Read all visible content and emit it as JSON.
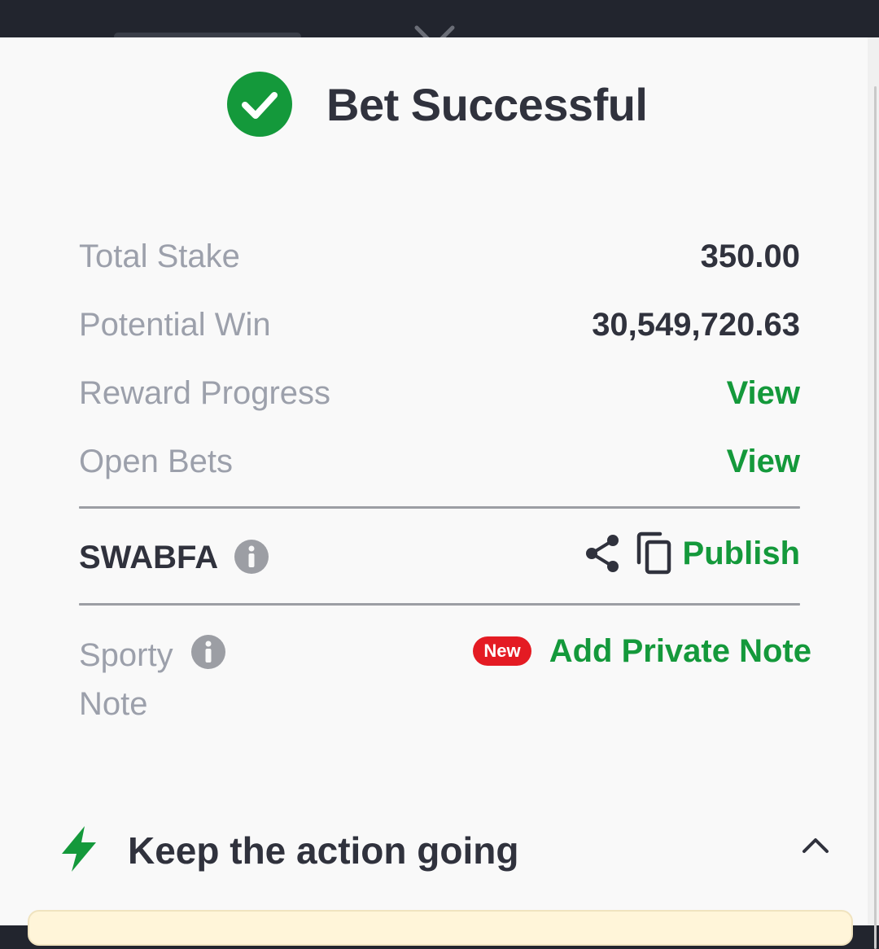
{
  "colors": {
    "accent_green": "#14993b",
    "text_dark": "#30323d",
    "text_muted": "#9ca0ab",
    "badge_red": "#e41b23",
    "sheet_bg": "#f9f9f9",
    "overlay_bg": "#22252e"
  },
  "header": {
    "icon": "check-circle-icon",
    "title": "Bet Successful"
  },
  "summary": {
    "rows": [
      {
        "label": "Total Stake",
        "value": "350.00"
      },
      {
        "label": "Potential Win",
        "value": "30,549,720.63"
      },
      {
        "label": "Reward Progress",
        "link": "View"
      },
      {
        "label": "Open Bets",
        "link": "View"
      }
    ]
  },
  "booking": {
    "code": "SWABFA",
    "info_icon": "info-icon",
    "share_icon": "share-icon",
    "copy_icon": "copy-icon",
    "publish_label": "Publish"
  },
  "note": {
    "label": "Sporty Note",
    "badge": "New",
    "action_label": "Add Private Note"
  },
  "promo": {
    "icon": "lightning-bolt-icon",
    "title": "Keep the action going",
    "toggle_icon": "chevron-up-icon"
  }
}
